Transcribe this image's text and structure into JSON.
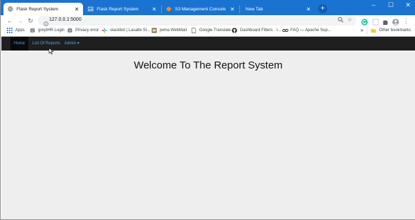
{
  "browser": {
    "tabs": [
      {
        "title": "Flask Report System",
        "active": true,
        "favicon": "globe-icon"
      },
      {
        "title": "Flask Report System",
        "active": false,
        "favicon": "broken-image-icon"
      },
      {
        "title": "S3 Management Console",
        "active": false,
        "favicon": "aws-icon"
      },
      {
        "title": "New Tab",
        "active": false,
        "favicon": null
      }
    ],
    "new_tab_label": "+",
    "window_controls": {
      "minimize": "–",
      "maximize": "☐",
      "close": "✕"
    },
    "url": "127.0.0.1:5000",
    "bookmarks": [
      {
        "label": "Apps",
        "icon": "apps-grid-icon"
      },
      {
        "label": "greytHR Login",
        "icon": "globe-icon"
      },
      {
        "label": "Privacy error",
        "icon": "globe-icon"
      },
      {
        "label": "slackbot | Lasalle Sl...",
        "icon": "slack-icon"
      },
      {
        "label": "jwma WebMail",
        "icon": "webmail-icon"
      },
      {
        "label": "Google Translate",
        "icon": "document-icon"
      },
      {
        "label": "Dashboard Filters · I...",
        "icon": "github-icon"
      },
      {
        "label": "FAQ — Apache Sup...",
        "icon": "link-icon"
      }
    ],
    "bookmarks_overflow": "»",
    "other_bookmarks": "Other bookmarks"
  },
  "app": {
    "nav": [
      {
        "label": "Home",
        "active": true
      },
      {
        "label": "List Of Reports",
        "active": false
      },
      {
        "label": "Admin ▾",
        "active": false
      }
    ],
    "heading": "Welcome To The Report System"
  },
  "colors": {
    "tabstrip": "#1a73d1",
    "navbar": "#1f1f1f",
    "nav_link": "#4fa6ea",
    "content_bg": "#eeeeee"
  }
}
